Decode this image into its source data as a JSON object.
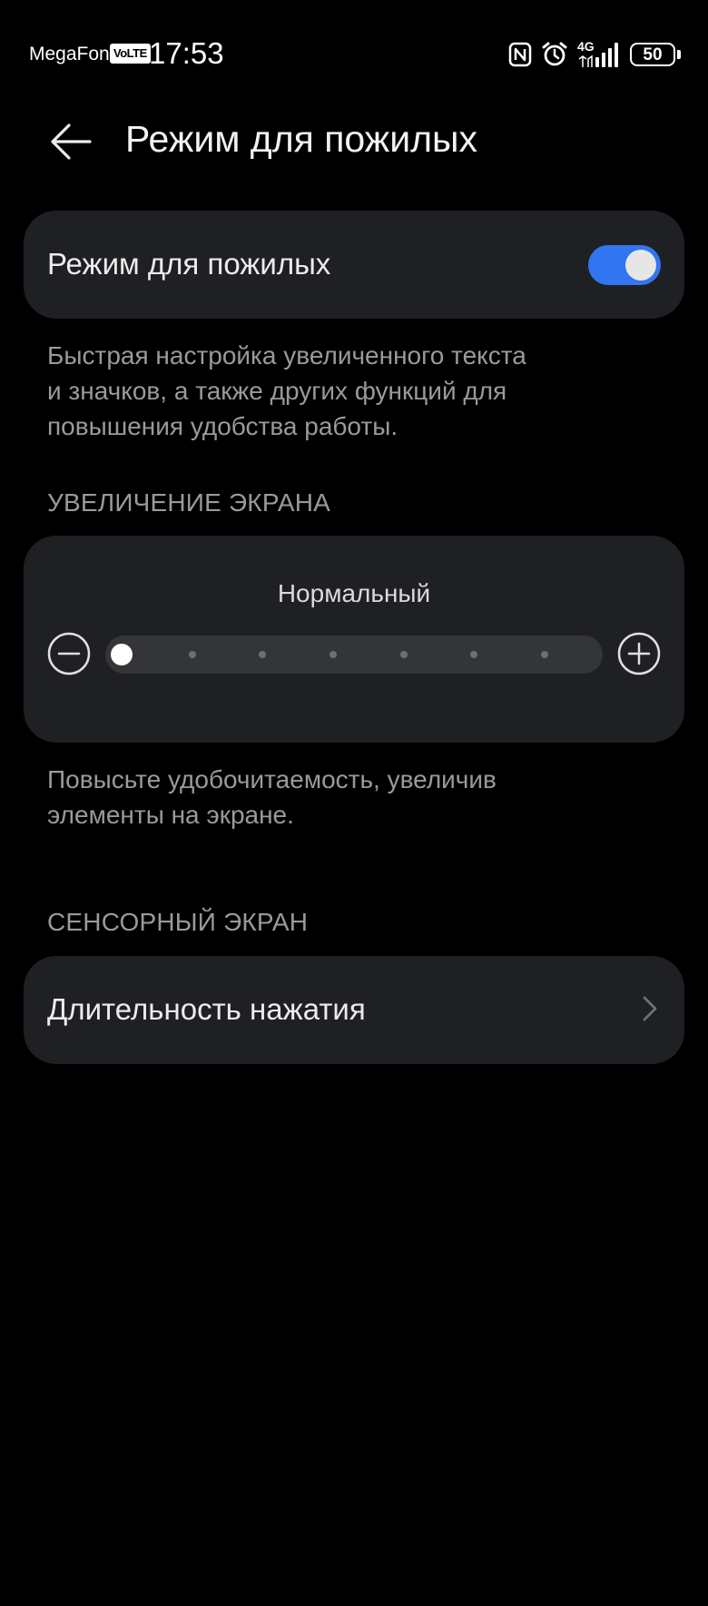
{
  "status_bar": {
    "carrier": "MegaFon",
    "volte": "VoLTE",
    "time": "17:53",
    "network": "4G",
    "battery": "50",
    "icons": [
      "nfc-icon",
      "alarm-icon",
      "signal-icon",
      "battery-icon"
    ]
  },
  "header": {
    "title": "Режим для пожилых",
    "back_icon": "arrow-left-icon"
  },
  "elderly_mode": {
    "label": "Режим для пожилых",
    "enabled": true,
    "description_lines": [
      "Быстрая настройка увеличенного текста",
      "и значков, а также других функций для",
      "повышения удобства работы."
    ]
  },
  "screen_zoom": {
    "section_title": "УВЕЛИЧЕНИЕ ЭКРАНА",
    "value_label": "Нормальный",
    "level": 1,
    "levels": 7,
    "description_lines": [
      "Повысьте удобочитаемость, увеличив",
      "элементы на экране."
    ]
  },
  "touch_screen": {
    "section_title": "СЕНСОРНЫЙ ЭКРАН",
    "items": [
      {
        "label": "Длительность нажатия"
      }
    ]
  },
  "colors": {
    "background": "#000000",
    "card": "#1F2023",
    "accent": "#3275F0",
    "secondary_text": "#9A9A9C"
  }
}
